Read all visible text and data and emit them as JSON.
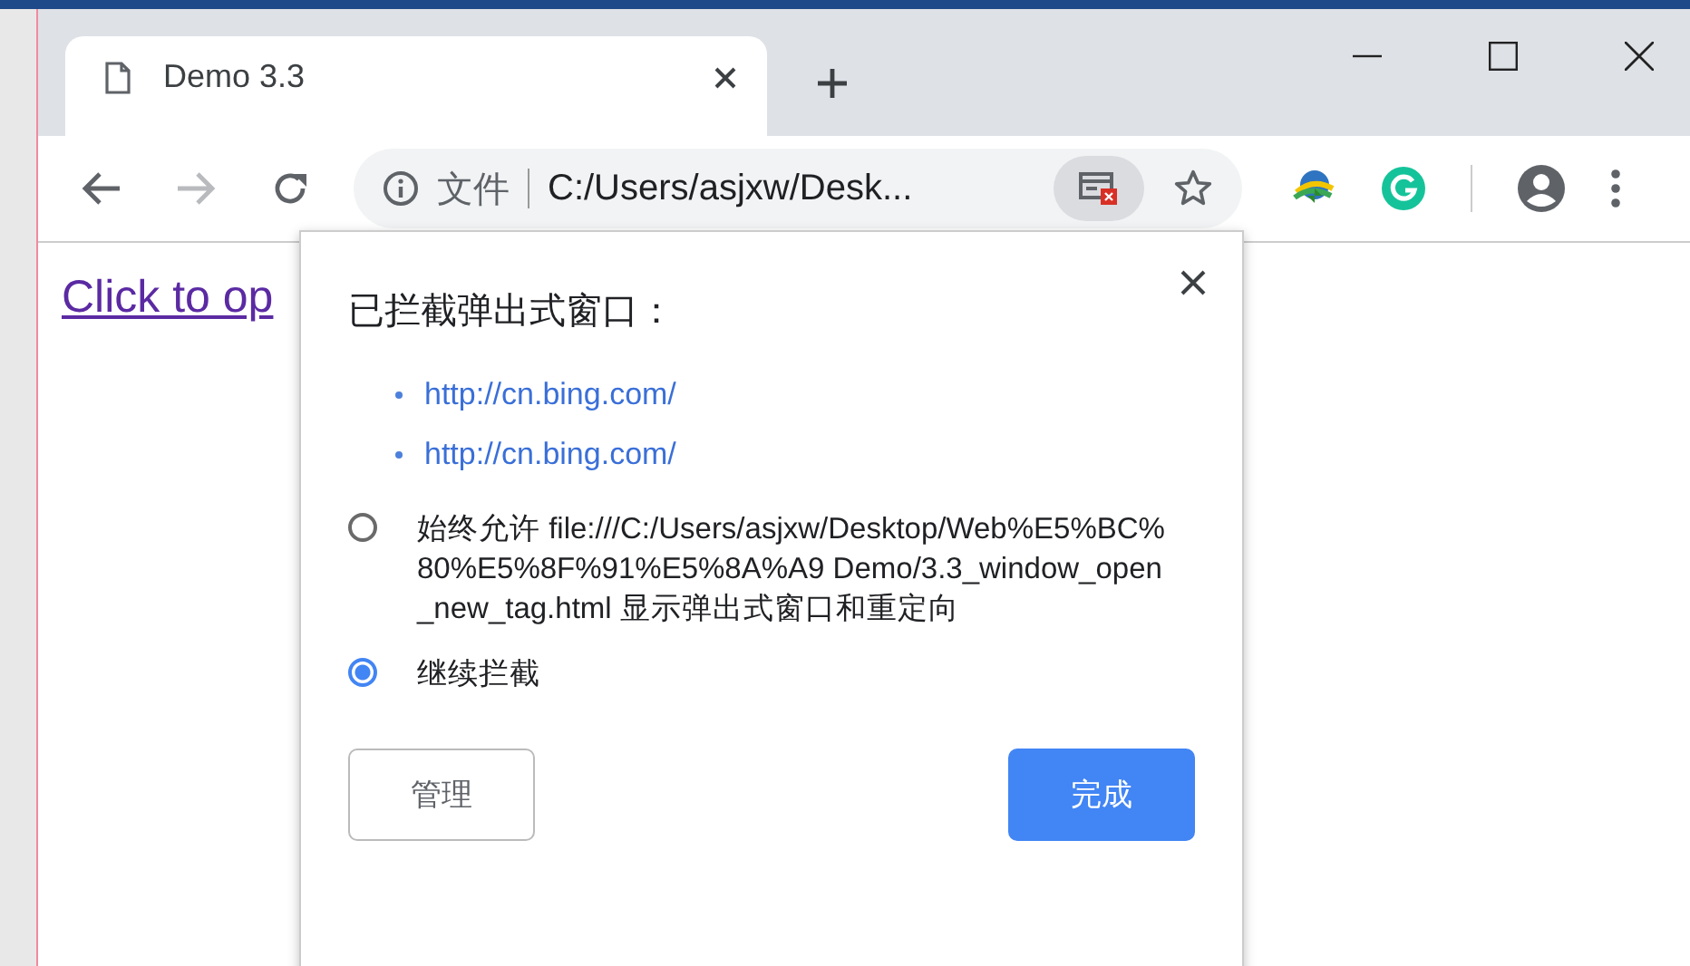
{
  "tab": {
    "title": "Demo 3.3",
    "selected": true
  },
  "address": {
    "security_label": "文件",
    "url": "C:/Users/asjxw/Desk..."
  },
  "page": {
    "link": "Click to op"
  },
  "popup": {
    "title": "已拦截弹出式窗口：",
    "links": [
      "http://cn.bing.com/",
      "http://cn.bing.com/"
    ],
    "options": [
      {
        "label": "始终允许 file:///C:/Users/asjxw/Desktop/Web%E5%BC%80%E5%8F%91%E5%8A%A9 Demo/3.3_window_open_new_tag.html 显示弹出式窗口和重定向",
        "selected": false
      },
      {
        "label": "继续拦截",
        "selected": true
      }
    ],
    "buttons": [
      {
        "label": "管理",
        "kind": "secondary"
      },
      {
        "label": "完成",
        "kind": "primary"
      }
    ]
  }
}
